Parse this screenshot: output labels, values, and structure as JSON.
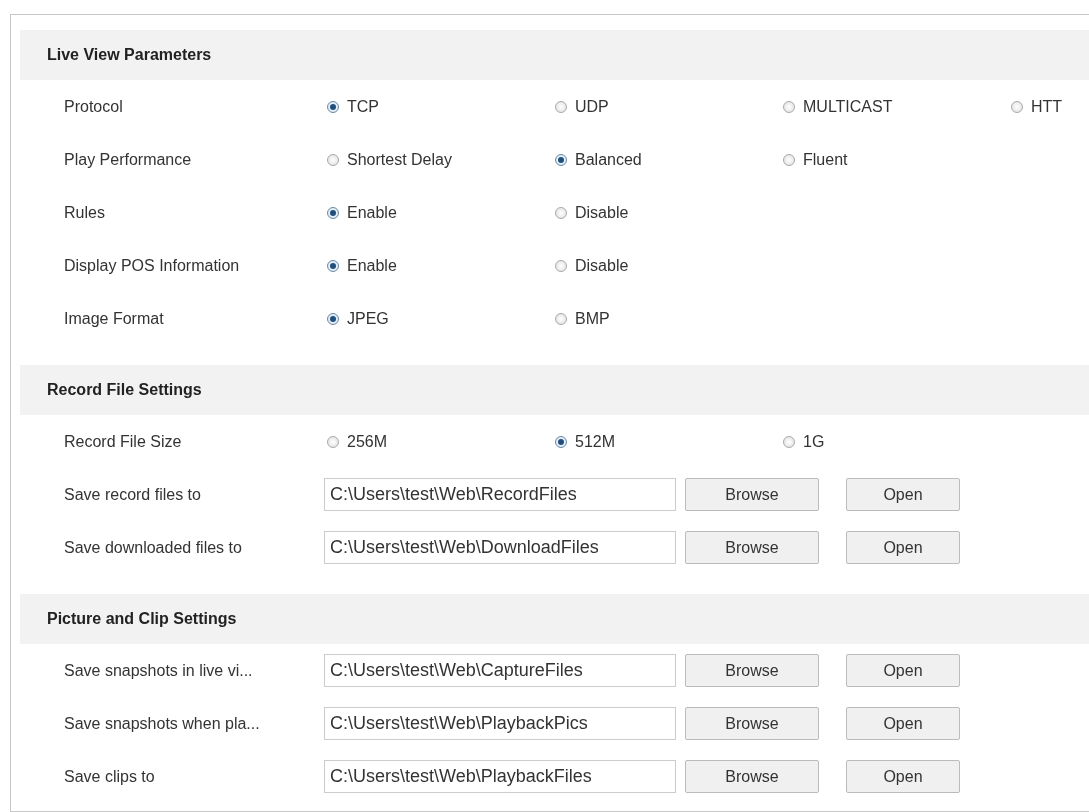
{
  "sections": [
    {
      "title": "Live View Parameters",
      "rows": [
        {
          "kind": "radio",
          "label": "Protocol",
          "options": [
            {
              "label": "TCP",
              "selected": true
            },
            {
              "label": "UDP",
              "selected": false
            },
            {
              "label": "MULTICAST",
              "selected": false
            },
            {
              "label": "HTT",
              "selected": false
            }
          ]
        },
        {
          "kind": "radio",
          "label": "Play Performance",
          "options": [
            {
              "label": "Shortest Delay",
              "selected": false
            },
            {
              "label": "Balanced",
              "selected": true
            },
            {
              "label": "Fluent",
              "selected": false
            }
          ]
        },
        {
          "kind": "radio",
          "label": "Rules",
          "options": [
            {
              "label": "Enable",
              "selected": true
            },
            {
              "label": "Disable",
              "selected": false
            }
          ]
        },
        {
          "kind": "radio",
          "label": "Display POS Information",
          "options": [
            {
              "label": "Enable",
              "selected": true
            },
            {
              "label": "Disable",
              "selected": false
            }
          ]
        },
        {
          "kind": "radio",
          "label": "Image Format",
          "options": [
            {
              "label": "JPEG",
              "selected": true
            },
            {
              "label": "BMP",
              "selected": false
            }
          ]
        }
      ]
    },
    {
      "title": "Record File Settings",
      "rows": [
        {
          "kind": "radio",
          "label": "Record File Size",
          "options": [
            {
              "label": "256M",
              "selected": false
            },
            {
              "label": "512M",
              "selected": true
            },
            {
              "label": "1G",
              "selected": false
            }
          ]
        },
        {
          "kind": "path",
          "label": "Save record files to",
          "value": "C:\\Users\\test\\Web\\RecordFiles",
          "buttons": [
            "Browse",
            "Open"
          ]
        },
        {
          "kind": "path",
          "label": "Save downloaded files to",
          "value": "C:\\Users\\test\\Web\\DownloadFiles",
          "buttons": [
            "Browse",
            "Open"
          ]
        }
      ]
    },
    {
      "title": "Picture and Clip Settings",
      "rows": [
        {
          "kind": "path",
          "label": "Save snapshots in live vi...",
          "value": "C:\\Users\\test\\Web\\CaptureFiles",
          "buttons": [
            "Browse",
            "Open"
          ]
        },
        {
          "kind": "path",
          "label": "Save snapshots when pla...",
          "value": "C:\\Users\\test\\Web\\PlaybackPics",
          "buttons": [
            "Browse",
            "Open"
          ]
        },
        {
          "kind": "path",
          "label": "Save clips to",
          "value": "C:\\Users\\test\\Web\\PlaybackFiles",
          "buttons": [
            "Browse",
            "Open"
          ]
        }
      ]
    }
  ]
}
